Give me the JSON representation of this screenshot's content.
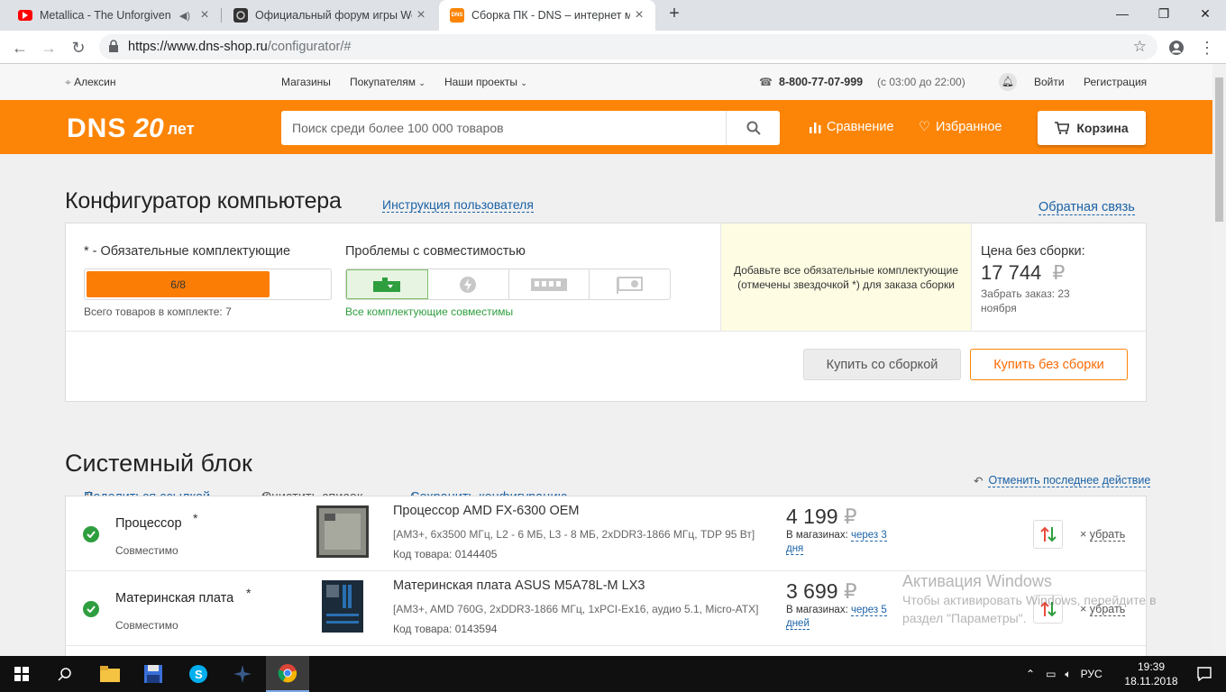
{
  "browser": {
    "tabs": [
      {
        "title": "Metallica - The Unforgiven (W",
        "icon": "youtube-icon",
        "audio": true
      },
      {
        "title": "Официальный форум игры Wor",
        "icon": "world-of-tanks-icon"
      },
      {
        "title": "Сборка ПК - DNS – интернет ма",
        "icon": "dns-icon",
        "favicon_text": "DNS",
        "active": true
      }
    ],
    "new_tab": "+",
    "url_host": "https://www.dns-shop.ru",
    "url_path": "/configurator/#",
    "window_controls": {
      "minimize": "—",
      "maximize": "❐",
      "close": "✕"
    }
  },
  "topline": {
    "city": "Алексин",
    "links": [
      "Магазины",
      "Покупателям",
      "Наши проекты"
    ],
    "phone": "8-800-77-07-999",
    "hours": "(с 03:00 до 22:00)",
    "login": "Войти",
    "register": "Регистрация"
  },
  "header": {
    "logo_text": "DNS",
    "logo_badge": "20",
    "logo_suffix": "лет",
    "search_placeholder": "Поиск среди более 100 000 товаров",
    "compare": "Сравнение",
    "favorites": "Избранное",
    "cart": "Корзина"
  },
  "configurator": {
    "title": "Конфигуратор компьютера",
    "instruction_link": "Инструкция пользователя",
    "feedback_link": "Обратная связь",
    "required_label": "* - Обязательные комплектующие",
    "progress_text": "6/8",
    "progress_fraction": 0.75,
    "total_items_label": "Всего товаров в комплекте:",
    "total_items_value": "7",
    "compat_title": "Проблемы с совместимостью",
    "compat_status": "Все комплектующие совместимы",
    "hint": "Добавьте все обязательные комплектующие (отмечены звездочкой *) для заказа сборки",
    "price_label": "Цена без сборки:",
    "price_value": "17 744",
    "currency": "₽",
    "pickup": "Забрать заказ: 23 ноября",
    "share": "Поделиться ссылкой",
    "clear": "Очистить список",
    "save": "Сохранить конфигурацию",
    "buy_assembled": "Купить со сборкой",
    "buy_unassembled": "Купить без сборки"
  },
  "system_unit": {
    "title": "Системный блок",
    "undo": "Отменить последнее действие",
    "rows": [
      {
        "category": "Процессор",
        "status": "Совместимо",
        "name": "Процессор AMD FX-6300 OEM",
        "spec": "[AM3+, 6x3500 МГц, L2 - 6 МБ, L3 - 8 МБ, 2xDDR3-1866 МГц, TDP 95 Вт]",
        "code": "Код товара: 0144405",
        "price": "4 199",
        "avail_prefix": "В магазинах:",
        "avail_link": "через 3 дня",
        "remove": "убрать"
      },
      {
        "category": "Материнская плата",
        "status": "Совместимо",
        "name": "Материнская плата ASUS M5A78L-M LX3",
        "spec": "[AM3+, AMD 760G, 2xDDR3-1866 МГц, 1xPCI-Ex16, аудио 5.1, Micro-ATX]",
        "code": "Код товара: 0143594",
        "price": "3 699",
        "avail_prefix": "В магазинах:",
        "avail_link": "через 5 дней",
        "remove": "убрать"
      }
    ]
  },
  "watermark": {
    "line1": "Активация Windows",
    "line2": "Чтобы активировать Windows, перейдите в",
    "line3": "раздел \"Параметры\"."
  },
  "taskbar": {
    "lang": "РУС",
    "time": "19:39",
    "date": "18.11.2018"
  },
  "colors": {
    "accent": "#fc8507",
    "link": "#1a62a6",
    "ok": "#2e9e3e"
  }
}
